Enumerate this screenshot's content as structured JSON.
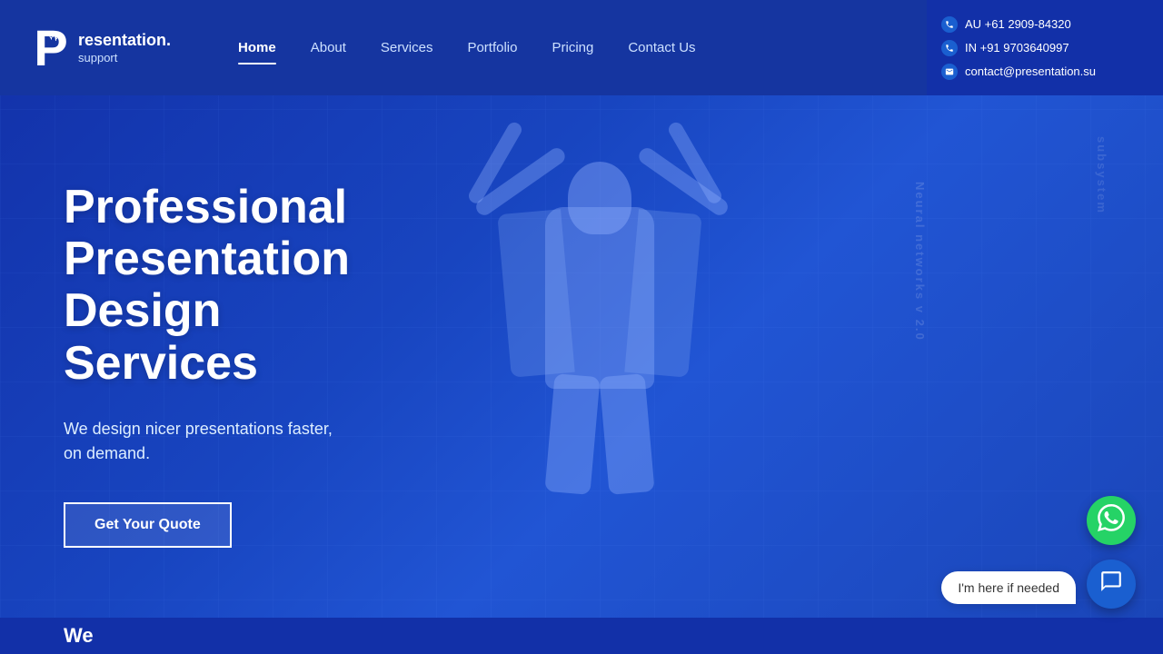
{
  "brand": {
    "logo_letter": "P",
    "logo_name": "resentation.",
    "logo_sub": "support"
  },
  "nav": {
    "items": [
      {
        "label": "Home",
        "active": true
      },
      {
        "label": "About",
        "active": false
      },
      {
        "label": "Services",
        "active": false
      },
      {
        "label": "Portfolio",
        "active": false
      },
      {
        "label": "Pricing",
        "active": false
      },
      {
        "label": "Contact Us",
        "active": false
      }
    ]
  },
  "contact_bar": {
    "au_phone": "AU +61 2909-84320",
    "in_phone": "IN +91 9703640997",
    "email": "contact@presentation.su"
  },
  "hero": {
    "title_line1": "Professional",
    "title_line2": "Presentation",
    "title_line3": "Design",
    "title_line4": "Services",
    "subtitle_line1": "We design nicer presentations faster,",
    "subtitle_line2": "on demand.",
    "cta_label": "Get Your Quote",
    "vertical_text1": "Neural networks v 2.0",
    "vertical_text2": "subsystem"
  },
  "bottom": {
    "teaser_text": "We"
  },
  "chat": {
    "bubble_text": "I'm here if needed",
    "whatsapp_icon": "💬",
    "chat_icon": "💬"
  }
}
